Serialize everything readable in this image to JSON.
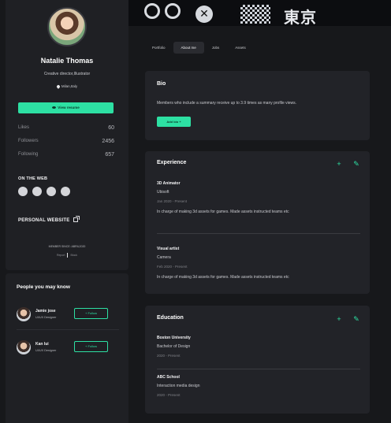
{
  "cover": {
    "kanji": "東京",
    "x_glyph": "✕"
  },
  "profile": {
    "name": "Natalie Thomas",
    "role": "Creative director,Illustrator",
    "location": "Milan,Italy",
    "resume_label": "View resume",
    "stats": [
      {
        "label": "Likes",
        "value": "60"
      },
      {
        "label": "Followers",
        "value": "2456"
      },
      {
        "label": "Following",
        "value": "657"
      }
    ],
    "on_the_web": "ON THE WEB",
    "personal_website": "PERSONAL WEBSITE",
    "member_since": "MEMBER SINCE: ABRIL2020",
    "report": "Report",
    "block": "Block"
  },
  "people": {
    "title": "People you may know",
    "follow_label": "Follow",
    "items": [
      {
        "name": "Jamie jose",
        "role": "UI/UX Designer"
      },
      {
        "name": "Kan lui",
        "role": "UI/UX Designer"
      }
    ]
  },
  "tabs": [
    {
      "label": "Portfolio",
      "active": false
    },
    {
      "label": "About me",
      "active": true
    },
    {
      "label": "Jobs",
      "active": false
    },
    {
      "label": "Assets",
      "active": false
    }
  ],
  "bio": {
    "title": "Bio",
    "text": "Members who include a summary receive up to 3.9 times as many profile views.",
    "add_label": "Add bio  +"
  },
  "experience": {
    "title": "Experience",
    "items": [
      {
        "title": "3D Animator",
        "company": "Ubisoft",
        "dates": "Jan 2020 - Present",
        "desc": "In charge of making 3d assets for games. Made assets instructed teams etc"
      },
      {
        "title": "Visual artist",
        "company": "Camera",
        "dates": "Feb 2020 - Present",
        "desc": "In charge of making 3d assets for games. Made assets instructed teams etc"
      }
    ]
  },
  "education": {
    "title": "Education",
    "items": [
      {
        "school": "Boston University",
        "degree": "Bachelor of Design",
        "dates": "2020 - Present"
      },
      {
        "school": "ABC School",
        "degree": "Interaction media design",
        "dates": "2020 - Present"
      }
    ]
  },
  "colors": {
    "accent": "#2de0a3",
    "bg": "#17181b",
    "card": "#222328"
  }
}
